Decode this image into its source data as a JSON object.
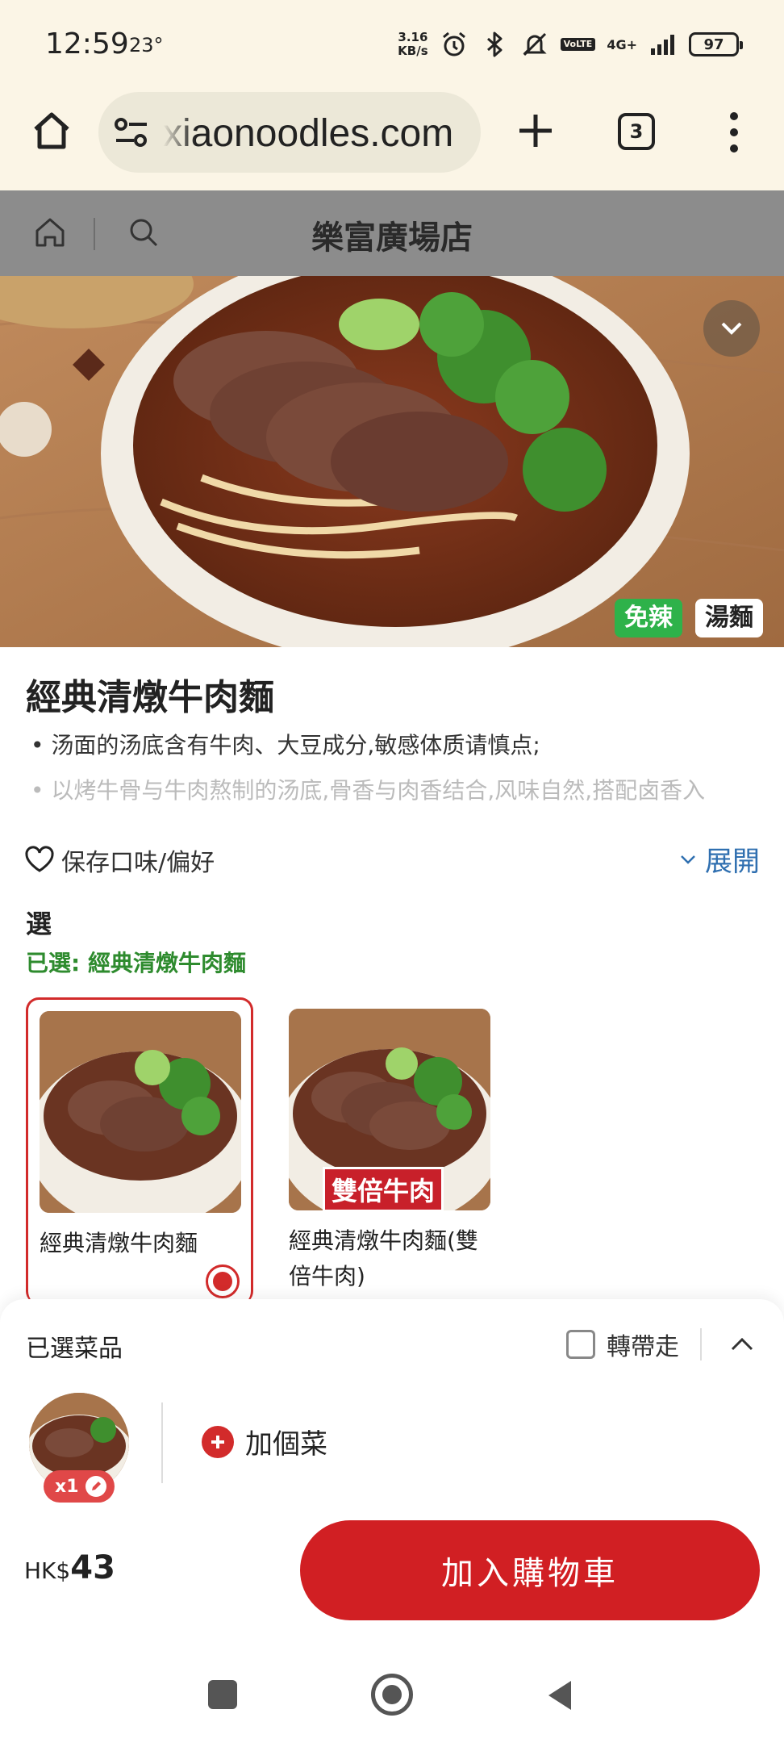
{
  "status_bar": {
    "time": "12:59",
    "temperature": "23°",
    "net_speed_value": "3.16",
    "net_speed_unit": "KB/s",
    "network": "4G+",
    "volte": "VoLTE",
    "battery": "97"
  },
  "browser": {
    "url": "xiaonoodles.com",
    "tab_count": "3"
  },
  "store_header": {
    "title": "樂富廣場店"
  },
  "product": {
    "tags": [
      "免辣",
      "湯麵"
    ],
    "title": "經典清燉牛肉麵",
    "desc_line1": "• 汤面的汤底含有牛肉、大豆成分,敏感体质请慎点;",
    "desc_line2": "• 以烤牛骨与牛肉熬制的汤底,骨香与肉香结合,风味自然,搭配卤香入",
    "save_pref_label": "保存口味/偏好",
    "expand_label": "展開"
  },
  "options": {
    "heading": "選",
    "selected_text": "已選: 經典清燉牛肉麵",
    "items": [
      {
        "name": "經典清燉牛肉麵",
        "selected": true
      },
      {
        "name": "經典清燉牛肉麵(雙倍牛肉)",
        "badge": "雙倍牛肉",
        "selected": false
      }
    ]
  },
  "cart_sheet": {
    "title": "已選菜品",
    "takeaway_label": "轉帶走",
    "item_qty": "x1",
    "add_dish_label": "加個菜",
    "price_currency": "HK$",
    "price_value": "43",
    "add_to_cart_label": "加入購物車"
  },
  "colors": {
    "accent_red": "#d11f23",
    "selected_green": "#2e8b2e",
    "spicy_tag_green": "#2eb24a",
    "link_blue": "#2f6fb0",
    "browser_bg": "#fbf5e6"
  },
  "icons": {
    "status": [
      "alarm-icon",
      "bluetooth-icon",
      "mute-icon",
      "signal-icon",
      "battery-icon"
    ],
    "browser": [
      "home-icon",
      "site-settings-icon",
      "new-tab-plus-icon",
      "tab-switcher-icon",
      "more-menu-icon"
    ],
    "store": [
      "home-icon",
      "search-icon"
    ],
    "navigation": [
      "recents-square-icon",
      "home-circle-icon",
      "back-triangle-icon"
    ]
  }
}
